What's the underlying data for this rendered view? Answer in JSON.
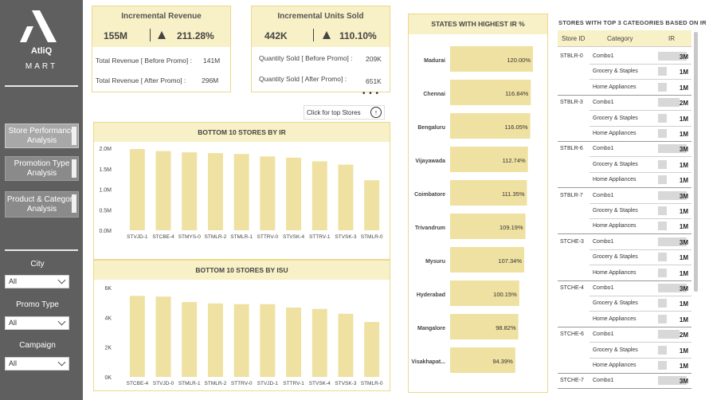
{
  "brand": {
    "name": "AtliQ",
    "sub": "MART",
    "logo_icon": "atliq-logo-icon"
  },
  "nav": [
    {
      "label": "Store  Performance Analysis",
      "active": true
    },
    {
      "label": "Promotion Type Analysis",
      "active": false
    },
    {
      "label": "Product & Category Analysis",
      "active": false
    }
  ],
  "filters": [
    {
      "label": "City",
      "value": "All"
    },
    {
      "label": "Promo Type",
      "value": "All"
    },
    {
      "label": "Campaign",
      "value": "All"
    }
  ],
  "kpi_revenue": {
    "title": "Incremental Revenue",
    "value": "155M",
    "pct": "211.28%",
    "row1_label": "Total Revenue [ Before Promo] :",
    "row1_value": "141M",
    "row2_label": "Total Revenue [ After Promo] :",
    "row2_value": "296M"
  },
  "kpi_units": {
    "title": "Incremental Units Sold",
    "value": "442K",
    "pct": "110.10%",
    "row1_label": "Quantity Sold [ Before Promo] :",
    "row1_value": "209K",
    "row2_label": "Quantity Sold [ After Promo] :",
    "row2_value": "651K"
  },
  "more_dots": "• • •",
  "top_button": {
    "label": "Click for top Stores",
    "icon": "arrow-up-icon"
  },
  "chart_data": [
    {
      "type": "bar",
      "title": "BOTTOM 10 STORES BY IR",
      "categories": [
        "STVJD-1",
        "STCBE-4",
        "STMYS-0",
        "STMLR-2",
        "STMLR-1",
        "STTRV-0",
        "STVSK-4",
        "STTRV-1",
        "STVSK-3",
        "STMLR-0"
      ],
      "values": [
        1.98,
        1.93,
        1.9,
        1.88,
        1.86,
        1.8,
        1.77,
        1.68,
        1.6,
        1.22
      ],
      "yticks": [
        "0.0M",
        "0.5M",
        "1.0M",
        "1.5M",
        "2.0M"
      ],
      "ylim": [
        0,
        2.0
      ],
      "color": "#efe1a1"
    },
    {
      "type": "bar",
      "title": "BOTTOM 10 STORES BY ISU",
      "categories": [
        "STCBE-4",
        "STVJD-0",
        "STMLR-1",
        "STMLR-2",
        "STTRV-0",
        "STVJD-1",
        "STTRV-1",
        "STVSK-4",
        "STVSK-3",
        "STMLR-0"
      ],
      "values": [
        5.9,
        5.85,
        5.45,
        5.35,
        5.3,
        5.3,
        5.05,
        4.95,
        4.6,
        4.0
      ],
      "yticks": [
        "0K",
        "2K",
        "4K",
        "6K"
      ],
      "ylim": [
        0,
        6.5
      ],
      "color": "#efe1a1"
    },
    {
      "type": "bar",
      "orientation": "horizontal",
      "title": "STATES WITH HIGHEST IR %",
      "categories": [
        "Madurai",
        "Chennai",
        "Bengaluru",
        "Vijayawada",
        "Coimbatore",
        "Trivandrum",
        "Mysuru",
        "Hyderabad",
        "Mangalore",
        "Visakhapat..."
      ],
      "values": [
        120.0,
        116.84,
        116.05,
        112.74,
        111.35,
        109.19,
        107.34,
        100.15,
        98.82,
        94.39
      ],
      "labels": [
        "120.00%",
        "116.84%",
        "116.05%",
        "112.74%",
        "111.35%",
        "109.19%",
        "107.34%",
        "100.15%",
        "98.82%",
        "94.39%"
      ],
      "color": "#efe1a1"
    }
  ],
  "table": {
    "title": "STORES WITH TOP 3 CATEGORIES BASED ON IR",
    "headers": [
      "Store ID",
      "Category",
      "IR"
    ],
    "groups": [
      {
        "store": "STBLR-0",
        "rows": [
          {
            "cat": "Combo1",
            "ir": "3M",
            "frac": 0.95
          },
          {
            "cat": "Grocery & Staples",
            "ir": "1M",
            "frac": 0.3
          },
          {
            "cat": "Home Appliances",
            "ir": "1M",
            "frac": 0.28
          }
        ]
      },
      {
        "store": "STBLR-3",
        "rows": [
          {
            "cat": "Combo1",
            "ir": "2M",
            "frac": 0.7
          },
          {
            "cat": "Grocery & Staples",
            "ir": "1M",
            "frac": 0.3
          },
          {
            "cat": "Home Appliances",
            "ir": "1M",
            "frac": 0.28
          }
        ]
      },
      {
        "store": "STBLR-6",
        "rows": [
          {
            "cat": "Combo1",
            "ir": "3M",
            "frac": 0.95
          },
          {
            "cat": "Grocery & Staples",
            "ir": "1M",
            "frac": 0.3
          },
          {
            "cat": "Home Appliances",
            "ir": "1M",
            "frac": 0.28
          }
        ]
      },
      {
        "store": "STBLR-7",
        "rows": [
          {
            "cat": "Combo1",
            "ir": "3M",
            "frac": 0.95
          },
          {
            "cat": "Grocery & Staples",
            "ir": "1M",
            "frac": 0.3
          },
          {
            "cat": "Home Appliances",
            "ir": "1M",
            "frac": 0.28
          }
        ]
      },
      {
        "store": "STCHE-3",
        "rows": [
          {
            "cat": "Combo1",
            "ir": "3M",
            "frac": 0.95
          },
          {
            "cat": "Grocery & Staples",
            "ir": "1M",
            "frac": 0.3
          },
          {
            "cat": "Home Appliances",
            "ir": "1M",
            "frac": 0.28
          }
        ]
      },
      {
        "store": "STCHE-4",
        "rows": [
          {
            "cat": "Combo1",
            "ir": "3M",
            "frac": 0.95
          },
          {
            "cat": "Grocery & Staples",
            "ir": "1M",
            "frac": 0.3
          },
          {
            "cat": "Home Appliances",
            "ir": "1M",
            "frac": 0.28
          }
        ]
      },
      {
        "store": "STCHE-6",
        "rows": [
          {
            "cat": "Combo1",
            "ir": "2M",
            "frac": 0.7
          },
          {
            "cat": "Grocery & Staples",
            "ir": "1M",
            "frac": 0.3
          },
          {
            "cat": "Home Appliances",
            "ir": "1M",
            "frac": 0.28
          }
        ]
      },
      {
        "store": "STCHE-7",
        "rows": [
          {
            "cat": "Combo1",
            "ir": "3M",
            "frac": 0.95
          }
        ]
      }
    ]
  }
}
